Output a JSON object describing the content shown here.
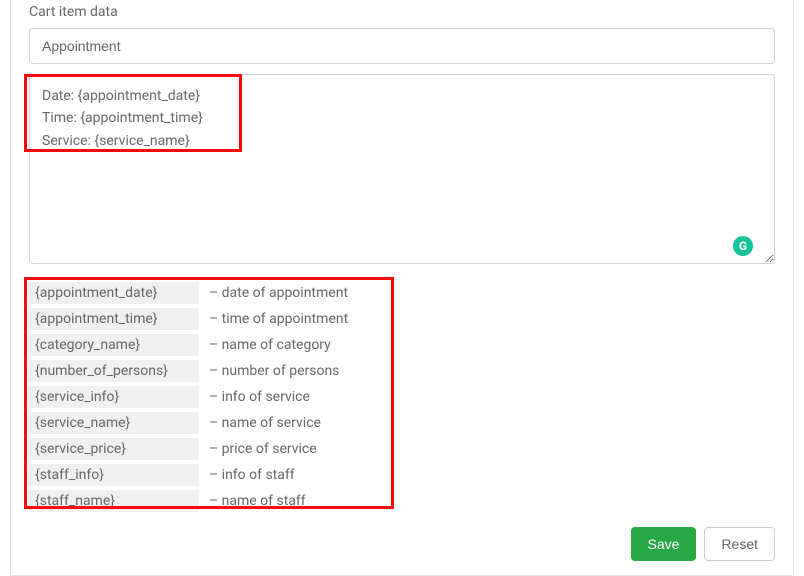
{
  "section_label": "Cart item data",
  "title_input_value": "Appointment",
  "body_textarea_value": "Date: {appointment_date}\nTime: {appointment_time}\nService: {service_name}",
  "grammarly_badge": "G",
  "tokens": [
    {
      "key": "{appointment_date}",
      "desc": "– date of appointment"
    },
    {
      "key": "{appointment_time}",
      "desc": "– time of appointment"
    },
    {
      "key": "{category_name}",
      "desc": "– name of category"
    },
    {
      "key": "{number_of_persons}",
      "desc": "– number of persons"
    },
    {
      "key": "{service_info}",
      "desc": "– info of service"
    },
    {
      "key": "{service_name}",
      "desc": "– name of service"
    },
    {
      "key": "{service_price}",
      "desc": "– price of service"
    },
    {
      "key": "{staff_info}",
      "desc": "– info of staff"
    },
    {
      "key": "{staff_name}",
      "desc": "– name of staff"
    }
  ],
  "buttons": {
    "save": "Save",
    "reset": "Reset"
  }
}
